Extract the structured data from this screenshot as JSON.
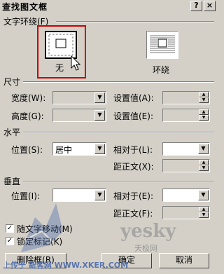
{
  "dialog": {
    "title": "查找图文框",
    "help_btn": "?",
    "close_btn": "×"
  },
  "wrapping": {
    "section": "文字环绕(F)",
    "options": [
      {
        "label": "无",
        "selected": true
      },
      {
        "label": "环绕",
        "selected": false
      }
    ]
  },
  "size": {
    "section": "尺寸",
    "width_label": "宽度(W):",
    "height_label": "高度(G):",
    "setting_label_a": "设置值(A):",
    "setting_label_e": "设置值(E):"
  },
  "horizontal": {
    "section": "水平",
    "position_label": "位置(S):",
    "position_value": "居中",
    "relative_label": "相对于(L):",
    "distance_label": "距正文(X):"
  },
  "vertical": {
    "section": "垂直",
    "position_label": "位置(I):",
    "relative_label": "相对于(E):",
    "distance_label": "距正文(F):"
  },
  "checkboxes": [
    {
      "label": "随文字移动(M)",
      "checked": true
    },
    {
      "label": "锁定标记(K)",
      "checked": true
    }
  ],
  "buttons": {
    "remove": "删除框(R)",
    "ok": "确定",
    "cancel": "取消"
  },
  "watermark": {
    "upload": "上传于 新客网 WWW.XKER.COM",
    "brand": "yesky",
    "brand_sub": "天极网"
  },
  "colors": {
    "face": "#d4d0c8",
    "highlight_box": "#cc0000"
  }
}
